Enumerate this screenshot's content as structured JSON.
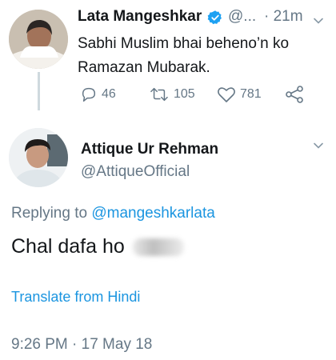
{
  "tweet": {
    "author_name": "Lata Mangeshkar",
    "author_handle": "@...",
    "time": "· 21m",
    "text": "Sabhi Muslim bhai beheno’n ko Ramazan Mubarak.",
    "actions": {
      "reply_count": "46",
      "retweet_count": "105",
      "like_count": "781"
    }
  },
  "reply": {
    "author_name": "Attique Ur Rehman",
    "author_handle": "@AttiqueOfficial",
    "replying_prefix": "Replying to ",
    "replying_handle": "@mangeshkarlata",
    "text": "Chal dafa ho",
    "translate_label": "Translate from Hindi",
    "timestamp": "9:26 PM · 17 May 18"
  },
  "colors": {
    "link": "#1b95e0",
    "muted": "#657786",
    "verified": "#1da1f2"
  }
}
